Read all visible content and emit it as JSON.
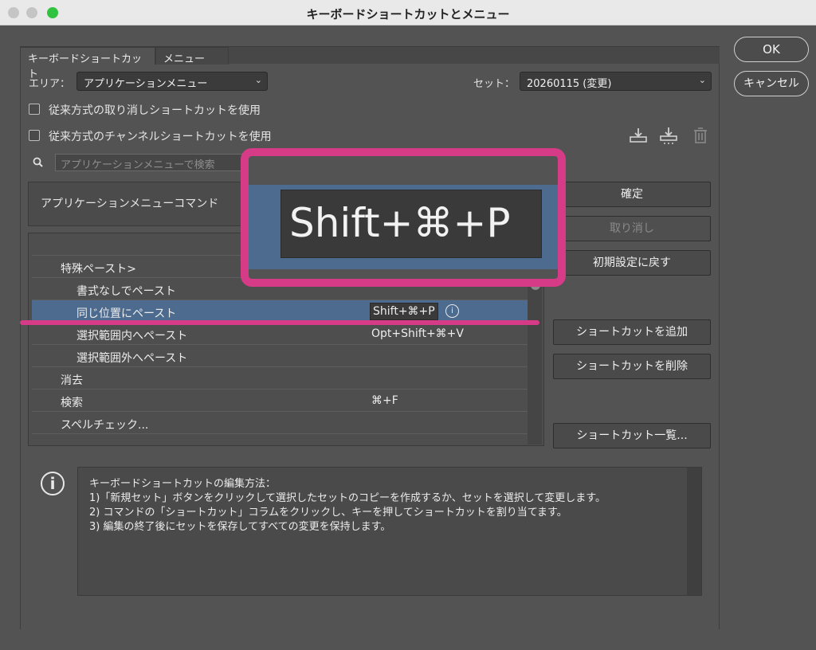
{
  "window": {
    "title": "キーボードショートカットとメニュー"
  },
  "tabs": [
    {
      "label": "キーボードショートカット"
    },
    {
      "label": "メニュー"
    }
  ],
  "area": {
    "label": "エリア：",
    "value": "アプリケーションメニュー"
  },
  "set": {
    "label": "セット：",
    "value": "20260115 (変更)"
  },
  "options": [
    {
      "label": "従来方式の取り消しショートカットを使用"
    },
    {
      "label": "従来方式のチャンネルショートカットを使用"
    }
  ],
  "search": {
    "placeholder": "アプリケーションメニューで検索"
  },
  "table": {
    "header": "アプリケーションメニューコマンド",
    "rows": [
      {
        "command": "特殊ペースト>",
        "shortcut": ""
      },
      {
        "command": "書式なしでペースト",
        "shortcut": ""
      },
      {
        "command": "同じ位置にペースト",
        "shortcut": "Shift+⌘+P"
      },
      {
        "command": "選択範囲内へペースト",
        "shortcut": "Opt+Shift+⌘+V"
      },
      {
        "command": "選択範囲外へペースト",
        "shortcut": ""
      },
      {
        "command": "消去",
        "shortcut": ""
      },
      {
        "command": "検索",
        "shortcut": "⌘+F"
      },
      {
        "command": "スペルチェック...",
        "shortcut": ""
      }
    ]
  },
  "actions": {
    "accept": "確定",
    "undo": "取り消し",
    "reset": "初期設定に戻す",
    "add": "ショートカットを追加",
    "delete": "ショートカットを削除",
    "summary": "ショートカット一覧..."
  },
  "dialog": {
    "ok": "OK",
    "cancel": "キャンセル"
  },
  "info": {
    "lines": [
      "キーボードショートカットの編集方法：",
      "1)「新規セット」ボタンをクリックして選択したセットのコピーを作成するか、セットを選択して変更します。",
      "2) コマンドの「ショートカット」コラムをクリックし、キーを押してショートカットを割り当てます。",
      "3) 編集の終了後にセットを保存してすべての変更を保持します。"
    ]
  },
  "zoom": {
    "text": "Shift+⌘+P"
  },
  "colors": {
    "accent": "#d53b86",
    "selection": "#4d6b8f",
    "close_light": "#2fc33f"
  },
  "icons": [
    "save-set-icon",
    "new-set-icon",
    "trash-icon",
    "search-icon",
    "info-icon",
    "chevron-down-icon"
  ]
}
